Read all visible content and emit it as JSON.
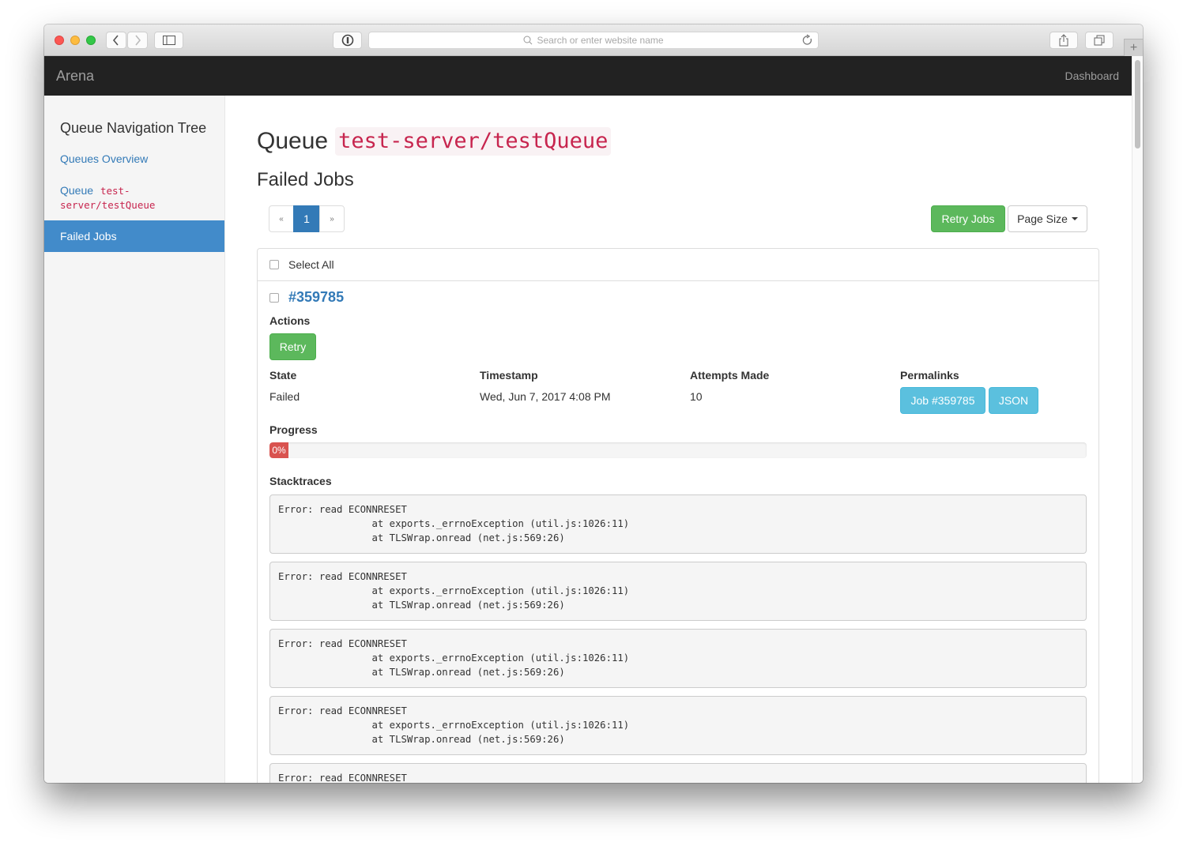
{
  "browser": {
    "address_placeholder": "Search or enter website name",
    "icons": [
      "back-icon",
      "forward-icon",
      "sidebar-icon",
      "password-icon",
      "search-icon",
      "reload-icon",
      "share-icon",
      "tabs-icon",
      "new-tab-icon"
    ]
  },
  "navbar": {
    "brand": "Arena",
    "dashboard_link": "Dashboard"
  },
  "sidebar": {
    "title": "Queue Navigation Tree",
    "items": [
      {
        "label": "Queues Overview"
      },
      {
        "label": "Queue",
        "code": "test-server/testQueue",
        "code_line1": "test-",
        "code_line2": "server/testQueue"
      },
      {
        "label": "Failed Jobs",
        "active": true
      }
    ]
  },
  "main": {
    "title_prefix": "Queue",
    "queue_name": "test-server/testQueue",
    "subtitle": "Failed Jobs",
    "pagination": {
      "prev": "«",
      "current": "1",
      "next": "»"
    },
    "retry_jobs_label": "Retry Jobs",
    "page_size_label": "Page Size",
    "select_all_label": "Select All",
    "job": {
      "id": "#359785",
      "actions_label": "Actions",
      "retry_label": "Retry",
      "state_label": "State",
      "state_value": "Failed",
      "timestamp_label": "Timestamp",
      "timestamp_value": "Wed, Jun 7, 2017 4:08 PM",
      "attempts_label": "Attempts Made",
      "attempts_value": "10",
      "permalinks_label": "Permalinks",
      "permalink_job": "Job #359785",
      "permalink_json": "JSON",
      "progress_label": "Progress",
      "progress_percent": 0,
      "progress_text": "0%",
      "stacktraces_label": "Stacktraces",
      "stacktraces": [
        "Error: read ECONNRESET\n                at exports._errnoException (util.js:1026:11)\n                at TLSWrap.onread (net.js:569:26)",
        "Error: read ECONNRESET\n                at exports._errnoException (util.js:1026:11)\n                at TLSWrap.onread (net.js:569:26)",
        "Error: read ECONNRESET\n                at exports._errnoException (util.js:1026:11)\n                at TLSWrap.onread (net.js:569:26)",
        "Error: read ECONNRESET\n                at exports._errnoException (util.js:1026:11)\n                at TLSWrap.onread (net.js:569:26)",
        "Error: read ECONNRESET"
      ]
    }
  },
  "colors": {
    "navbar_bg": "#222222",
    "active_nav": "#428bca",
    "link": "#337ab7",
    "code": "#c7254e",
    "success": "#5cb85c",
    "info": "#5bc0de",
    "danger": "#d9534f"
  }
}
